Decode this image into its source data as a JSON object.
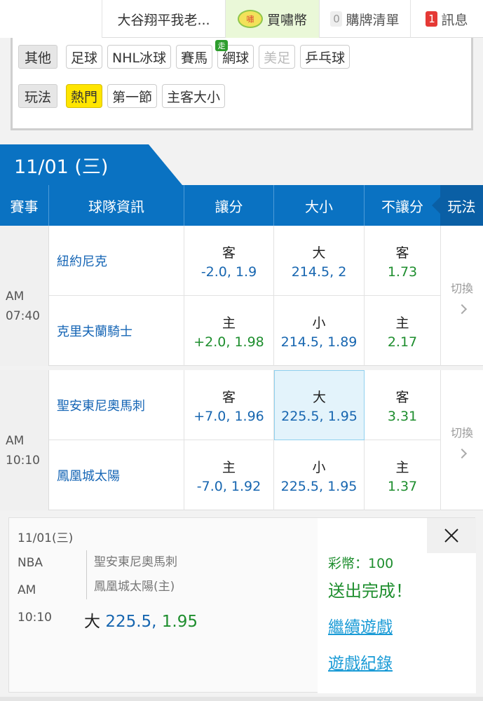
{
  "topbar": {
    "user": "大谷翔平我老...",
    "coin_icon": "嘯",
    "buy": "買嘯幣",
    "cart_count": "0",
    "cart": "購牌清單",
    "msg_count": "1",
    "msg": "訊息"
  },
  "filter": {
    "others_label": "其他",
    "sports": [
      "足球",
      "NHL冰球",
      "賽馬",
      "網球",
      "美足",
      "乒乓球"
    ],
    "live_badge": "走",
    "play_label": "玩法",
    "plays": [
      "熱門",
      "第一節",
      "主客大小"
    ]
  },
  "date": "11/01 (三)",
  "header": {
    "event": "賽事",
    "team": "球隊資訊",
    "spread": "讓分",
    "total": "大小",
    "moneyline": "不讓分",
    "play": "玩法"
  },
  "games": [
    {
      "ampm": "AM",
      "time": "07:40",
      "away": {
        "team": "紐約尼克",
        "spread_l": "客",
        "spread_v": "-2.0, 1.9",
        "total_l": "大",
        "total_v": "214.5, 2",
        "ml_l": "客",
        "ml_v": "1.73"
      },
      "home": {
        "team": "克里夫蘭騎士",
        "spread_l": "主",
        "spread_v": "+2.0, 1.98",
        "total_l": "小",
        "total_v": "214.5, 1.89",
        "ml_l": "主",
        "ml_v": "2.17"
      },
      "switch": "切換"
    },
    {
      "ampm": "AM",
      "time": "10:10",
      "away": {
        "team": "聖安東尼奧馬刺",
        "spread_l": "客",
        "spread_v": "+7.0, 1.96",
        "total_l": "大",
        "total_v": "225.5, 1.95",
        "ml_l": "客",
        "ml_v": "3.31"
      },
      "home": {
        "team": "鳳凰城太陽",
        "spread_l": "主",
        "spread_v": "-7.0, 1.92",
        "total_l": "小",
        "total_v": "225.5, 1.95",
        "ml_l": "主",
        "ml_v": "1.37"
      },
      "switch": "切換"
    }
  ],
  "confirm": {
    "date": "11/01(三)",
    "league": "NBA",
    "ampm": "AM",
    "time": "10:10",
    "team1": "聖安東尼奧馬刺",
    "team2": "鳳凰城太陽(主)",
    "bet_label": "大",
    "bet_line": "225.5,",
    "bet_odds": "1.95",
    "coins": "彩幣：100",
    "done": "送出完成！",
    "continue": "繼續遊戲",
    "history": "遊戲紀錄"
  }
}
